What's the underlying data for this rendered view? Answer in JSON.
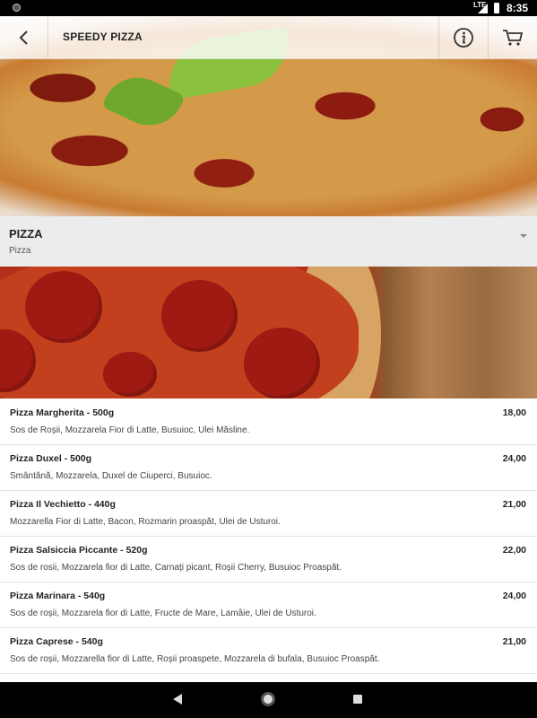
{
  "status_bar": {
    "network": "LTE",
    "time": "8:35"
  },
  "app_bar": {
    "title": "SPEEDY PIZZA",
    "back_icon": "chevron-left-icon",
    "info_icon": "info-icon",
    "cart_icon": "cart-icon"
  },
  "category": {
    "title": "PIZZA",
    "subtitle": "Pizza",
    "caret_icon": "caret-down-icon"
  },
  "products": [
    {
      "name": "Pizza Margherita - 500g",
      "price": "18,00",
      "description": "Sos de Roșii, Mozzarela Fior di Latte, Busuioc, Ulei Măsline."
    },
    {
      "name": "Pizza Duxel - 500g",
      "price": "24,00",
      "description": "Smântână, Mozzarela, Duxel de Ciuperci, Busuioc."
    },
    {
      "name": "Pizza Il Vechietto - 440g",
      "price": "21,00",
      "description": "Mozzarella Fior di Latte, Bacon, Rozmarin proaspăt, Ulei de Usturoi."
    },
    {
      "name": "Pizza Salsiccia Piccante - 520g",
      "price": "22,00",
      "description": "Sos de rosii, Mozzarela fior di Latte, Carnați picant, Roșii Cherry, Busuioc Proaspăt."
    },
    {
      "name": "Pizza Marinara - 540g",
      "price": "24,00",
      "description": "Sos de roșii, Mozzarela fior di Latte, Fructe de Mare, Lamâie, Ulei de Usturoi."
    },
    {
      "name": "Pizza Caprese - 540g",
      "price": "21,00",
      "description": "Sos de roșii, Mozzarella fior di Latte, Roșii proaspete, Mozzarela di bufala, Busuioc Proaspăt."
    }
  ],
  "nav_bar": {
    "back": "nav-back-icon",
    "home": "nav-home-icon",
    "recents": "nav-recents-icon"
  }
}
